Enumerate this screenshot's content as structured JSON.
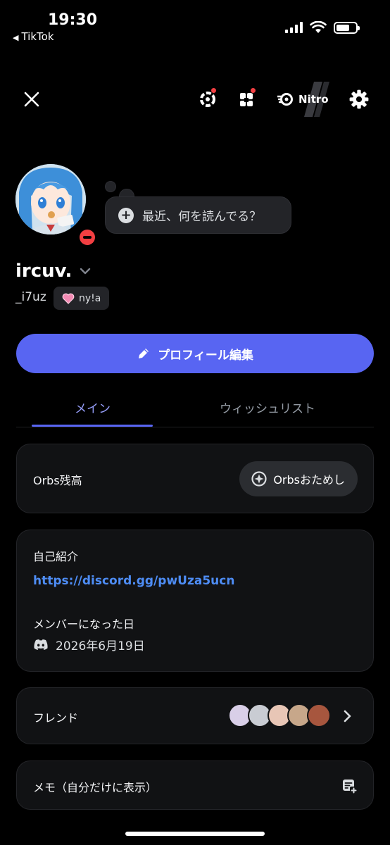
{
  "status_bar": {
    "time": "19:30",
    "back_app": "TikTok"
  },
  "header": {
    "nitro_label": "Nitro",
    "icons": [
      "close-icon",
      "quests-icon",
      "shop-icon",
      "nitro-icon",
      "gear-icon"
    ]
  },
  "profile": {
    "status_placeholder": "最近、何を読んでる？",
    "display_name": "ircuv.",
    "username": "_i7uz",
    "tag_label": "ny!a",
    "edit_button": "プロフィール編集",
    "presence": "dnd"
  },
  "tabs": [
    {
      "label": "メイン",
      "active": true
    },
    {
      "label": "ウィッシュリスト",
      "active": false
    }
  ],
  "orbs": {
    "label": "Orbs残高",
    "button": "Orbsおためし"
  },
  "bio": {
    "heading": "自己紹介",
    "link": "https://discord.gg/pwUza5ucn",
    "member_since_heading": "メンバーになった日",
    "member_since_date": "2026年6月19日"
  },
  "friends": {
    "label": "フレンド"
  },
  "memo": {
    "label": "メモ（自分だけに表示）"
  },
  "colors": {
    "accent": "#5865f2",
    "tab_active": "#949cf7",
    "link": "#4e8df5",
    "dnd": "#f23f42",
    "card_bg": "#111214"
  }
}
